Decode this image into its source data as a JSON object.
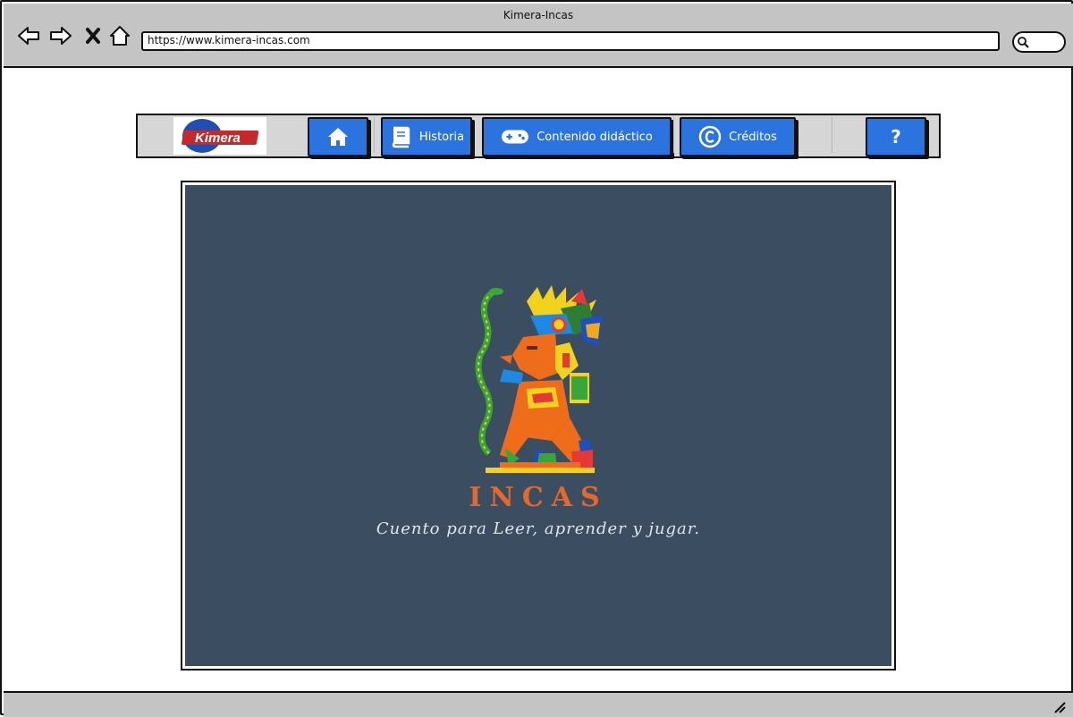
{
  "window": {
    "title": "Kimera-Incas"
  },
  "toolbar": {
    "url": "https://www.kimera-incas.com",
    "icons": [
      "back-icon",
      "forward-icon",
      "close-icon",
      "home-icon",
      "search-icon"
    ]
  },
  "navbar": {
    "logo_text": "Kimera",
    "items": [
      {
        "label": "",
        "icon": "home-icon"
      },
      {
        "label": "Historia",
        "icon": "book-icon"
      },
      {
        "label": "Contenido didáctico",
        "icon": "gamepad-icon"
      },
      {
        "label": "Créditos",
        "icon": "copyright-icon"
      },
      {
        "label": "",
        "icon": "help-icon"
      }
    ],
    "help_symbol": "?"
  },
  "hero": {
    "title": "INCAS",
    "subtitle": "Cuento para Leer, aprender y jugar."
  },
  "colors": {
    "chrome": "#c4c4c4",
    "nav_button": "#2b73de",
    "stage_bg": "#3b4d61",
    "title_orange": "#e8672a"
  }
}
